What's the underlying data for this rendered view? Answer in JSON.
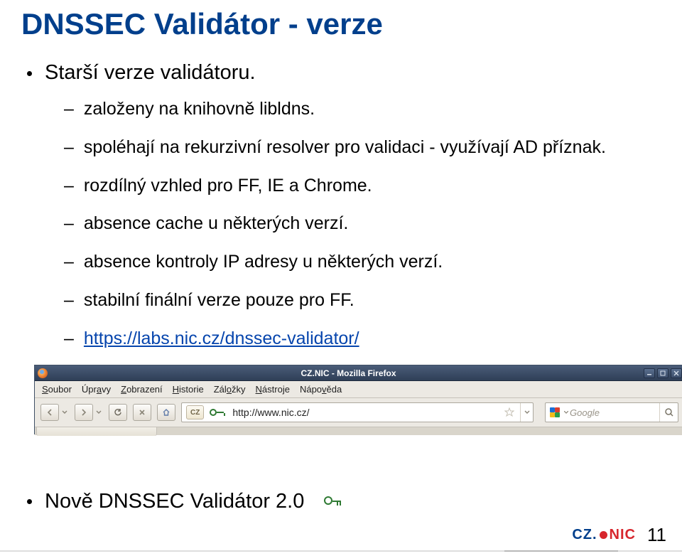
{
  "title": "DNSSEC Validátor - verze",
  "bullet_top": "Starší verze validátoru.",
  "sub_items": [
    "založeny na knihovně libldns.",
    "spoléhají na rekurzivní resolver pro validaci - využívají AD příznak.",
    "rozdílný vzhled pro FF, IE a Chrome.",
    "absence cache u některých verzí.",
    "absence kontroly IP adresy u některých verzí.",
    "stabilní finální verze pouze pro FF."
  ],
  "link_text": "https://labs.nic.cz/dnssec-validator/",
  "screenshot": {
    "window_title": "CZ.NIC - Mozilla Firefox",
    "menu": [
      "Soubor",
      "Úpravy",
      "Zobrazení",
      "Historie",
      "Záložky",
      "Nástroje",
      "Nápověda"
    ],
    "cz_badge": "CZ",
    "url": "http://www.nic.cz/",
    "search_placeholder": "Google"
  },
  "bottom_bullet": "Nově DNSSEC Validátor 2.0",
  "page_number": "11",
  "logo": {
    "cz": "CZ.",
    "nic": "NIC"
  }
}
